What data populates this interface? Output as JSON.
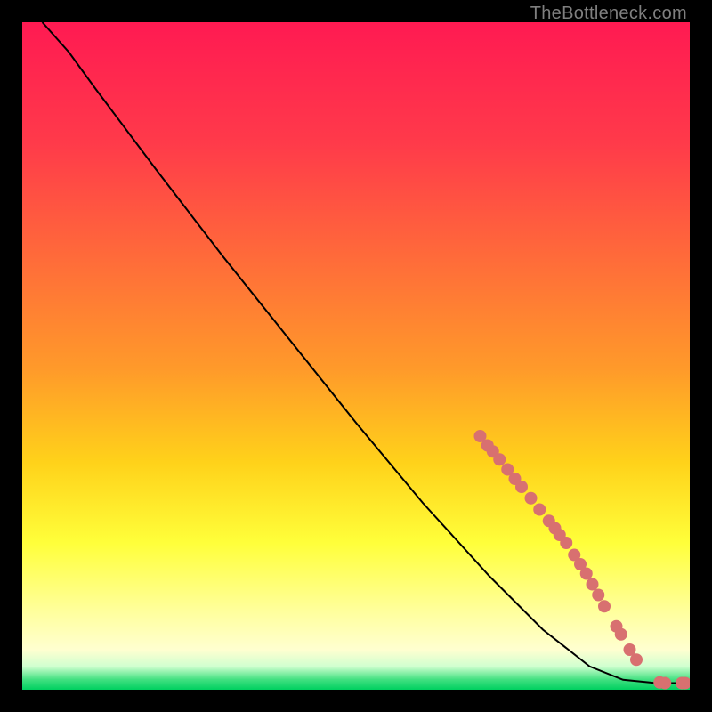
{
  "watermark": "TheBottleneck.com",
  "chart_data": {
    "type": "line",
    "title": "",
    "xlabel": "",
    "ylabel": "",
    "xlim": [
      0,
      100
    ],
    "ylim": [
      0,
      100
    ],
    "gradient_stops": [
      {
        "offset": 0,
        "color": "#ff1a52"
      },
      {
        "offset": 0.18,
        "color": "#ff3a4a"
      },
      {
        "offset": 0.35,
        "color": "#ff6a3a"
      },
      {
        "offset": 0.52,
        "color": "#ff9a2a"
      },
      {
        "offset": 0.66,
        "color": "#ffd21a"
      },
      {
        "offset": 0.78,
        "color": "#ffff3a"
      },
      {
        "offset": 0.88,
        "color": "#ffff9a"
      },
      {
        "offset": 0.94,
        "color": "#ffffd0"
      },
      {
        "offset": 0.965,
        "color": "#d0ffd0"
      },
      {
        "offset": 0.985,
        "color": "#40e080"
      },
      {
        "offset": 1.0,
        "color": "#00d060"
      }
    ],
    "curve_points": [
      {
        "x": 3.0,
        "y": 100.0
      },
      {
        "x": 7.0,
        "y": 95.5
      },
      {
        "x": 11.0,
        "y": 90.0
      },
      {
        "x": 20.0,
        "y": 78.0
      },
      {
        "x": 30.0,
        "y": 65.0
      },
      {
        "x": 40.0,
        "y": 52.5
      },
      {
        "x": 50.0,
        "y": 40.0
      },
      {
        "x": 60.0,
        "y": 28.0
      },
      {
        "x": 70.0,
        "y": 17.0
      },
      {
        "x": 78.0,
        "y": 9.0
      },
      {
        "x": 85.0,
        "y": 3.5
      },
      {
        "x": 90.0,
        "y": 1.5
      },
      {
        "x": 95.0,
        "y": 1.0
      },
      {
        "x": 99.0,
        "y": 1.0
      }
    ],
    "marker_points": [
      {
        "x": 68.6,
        "y": 38.0
      },
      {
        "x": 69.7,
        "y": 36.6
      },
      {
        "x": 70.5,
        "y": 35.7
      },
      {
        "x": 71.5,
        "y": 34.5
      },
      {
        "x": 72.7,
        "y": 33.0
      },
      {
        "x": 73.8,
        "y": 31.6
      },
      {
        "x": 74.8,
        "y": 30.4
      },
      {
        "x": 76.2,
        "y": 28.7
      },
      {
        "x": 77.5,
        "y": 27.0
      },
      {
        "x": 78.9,
        "y": 25.3
      },
      {
        "x": 79.8,
        "y": 24.2
      },
      {
        "x": 80.5,
        "y": 23.2
      },
      {
        "x": 81.5,
        "y": 22.0
      },
      {
        "x": 82.7,
        "y": 20.2
      },
      {
        "x": 83.6,
        "y": 18.8
      },
      {
        "x": 84.5,
        "y": 17.4
      },
      {
        "x": 85.4,
        "y": 15.8
      },
      {
        "x": 86.3,
        "y": 14.2
      },
      {
        "x": 87.2,
        "y": 12.5
      },
      {
        "x": 89.0,
        "y": 9.5
      },
      {
        "x": 89.7,
        "y": 8.3
      },
      {
        "x": 91.0,
        "y": 6.0
      },
      {
        "x": 92.0,
        "y": 4.5
      },
      {
        "x": 95.5,
        "y": 1.1
      },
      {
        "x": 96.3,
        "y": 1.0
      },
      {
        "x": 98.8,
        "y": 1.0
      },
      {
        "x": 99.3,
        "y": 1.0
      }
    ],
    "marker_color": "#d87070",
    "line_color": "#000000"
  }
}
